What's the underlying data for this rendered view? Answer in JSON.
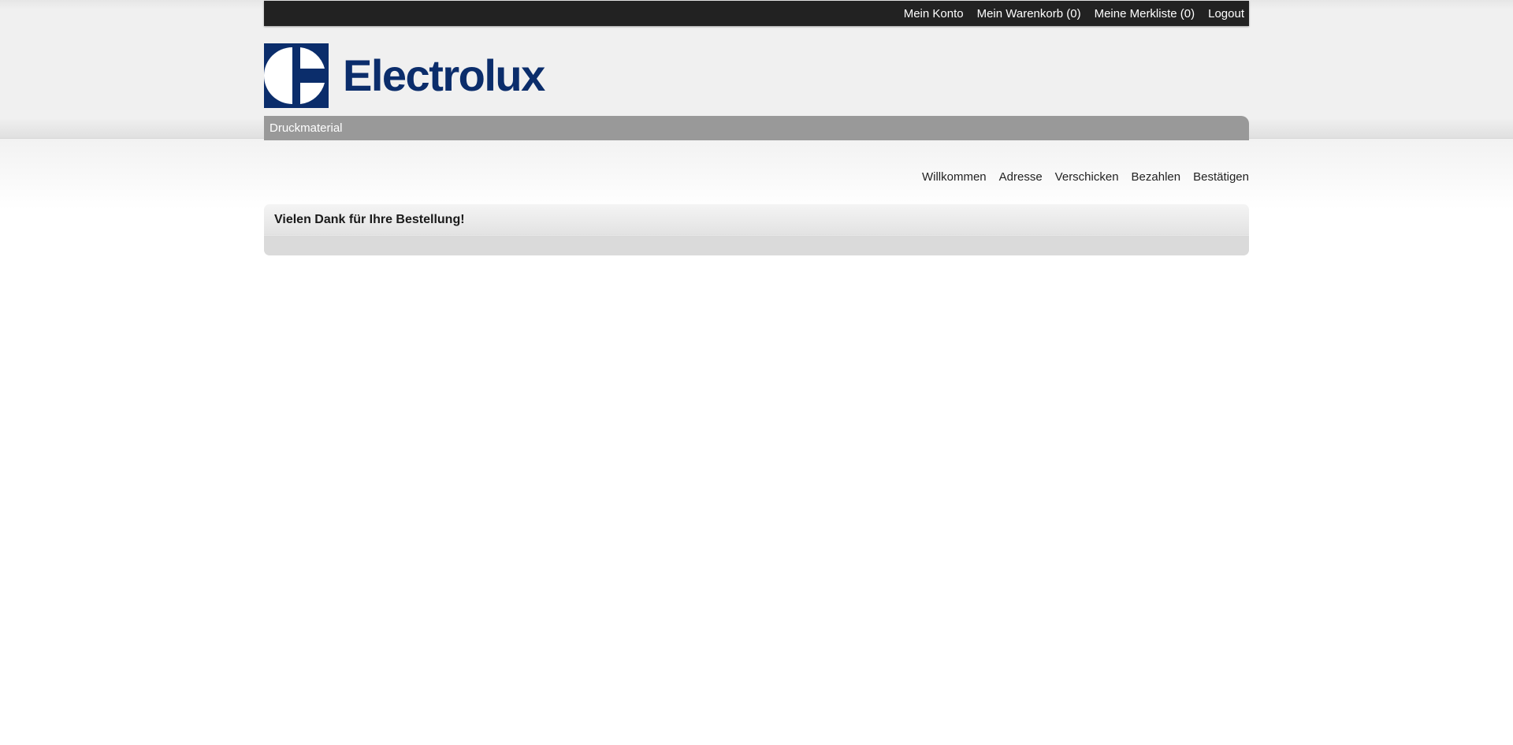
{
  "topbar": {
    "links": [
      {
        "label": "Mein Konto"
      },
      {
        "label": "Mein Warenkorb (0)"
      },
      {
        "label": "Meine Merkliste (0)"
      },
      {
        "label": "Logout"
      }
    ]
  },
  "brand": {
    "name": "Electrolux",
    "color": "#0b2d6b"
  },
  "nav": {
    "items": [
      {
        "label": "Druckmaterial"
      }
    ]
  },
  "checkout_steps": [
    {
      "label": "Willkommen"
    },
    {
      "label": "Adresse"
    },
    {
      "label": "Verschicken"
    },
    {
      "label": "Bezahlen"
    },
    {
      "label": "Bestätigen"
    }
  ],
  "confirmation": {
    "title": "Vielen Dank für Ihre Bestellung!"
  }
}
